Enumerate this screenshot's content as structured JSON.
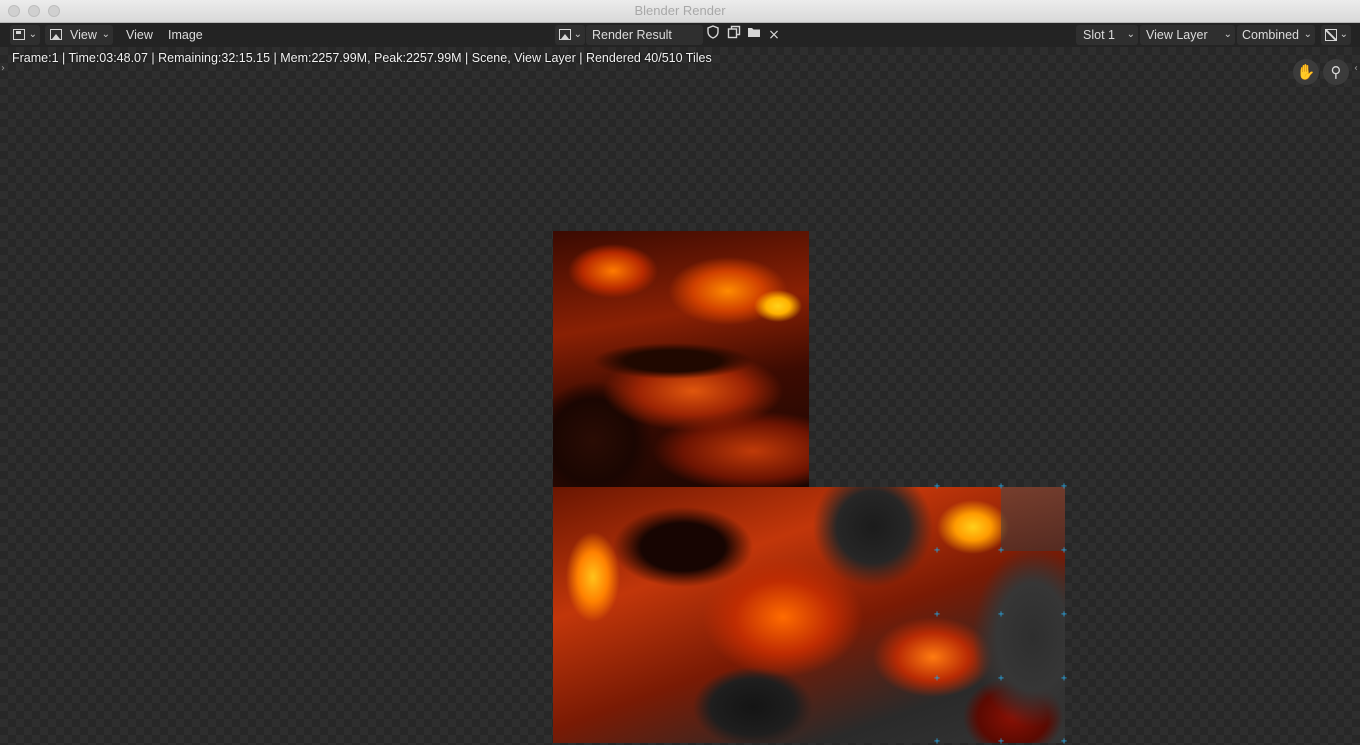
{
  "window": {
    "title": "Blender Render"
  },
  "header": {
    "mode_label": "View",
    "menus": [
      "View",
      "Image"
    ],
    "image_name": "Render Result",
    "slot": "Slot 1",
    "view_layer": "View Layer",
    "pass": "Combined",
    "chevron": "⌄",
    "close_glyph": "×"
  },
  "viewport": {
    "stats": "Frame:1 | Time:03:48.07 | Remaining:32:15.15 | Mem:2257.99M, Peak:2257.99M | Scene, View Layer | Rendered 40/510 Tiles",
    "left_arrow": "›",
    "right_arrow": "‹",
    "hand_icon": "✋",
    "zoom_icon": "⚲"
  },
  "icons": {
    "editor_type": "image-editor-icon",
    "fake_user": "shield-icon",
    "new_image": "duplicate-icon",
    "open_image": "folder-icon",
    "unlink": "close-icon",
    "display_channels": "display-channels-icon"
  },
  "colors": {
    "header_bg": "#232323",
    "widget_bg": "#2f2f2f",
    "tile_marker": "#2aa0d8"
  },
  "render": {
    "tiles_rendered": 40,
    "tiles_total": 510
  }
}
